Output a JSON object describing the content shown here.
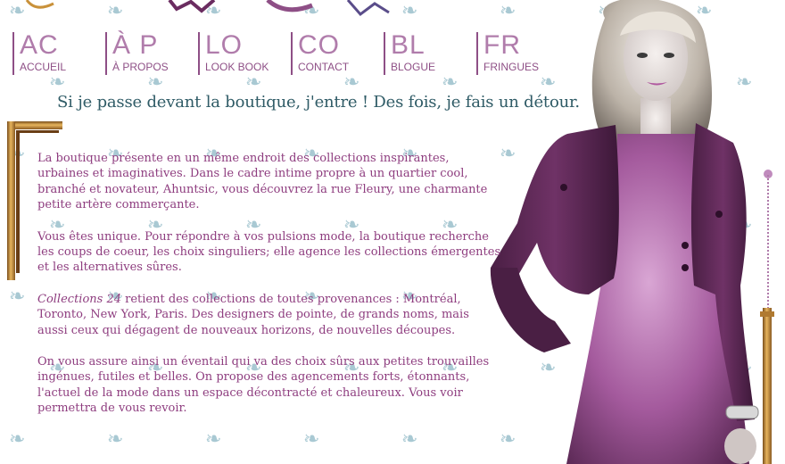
{
  "nav": {
    "items": [
      {
        "abbr": "AC",
        "label": "ACCUEIL"
      },
      {
        "abbr": "À P",
        "label": "À PROPOS"
      },
      {
        "abbr": "LO",
        "label": "LOOK BOOK"
      },
      {
        "abbr": "CO",
        "label": "CONTACT"
      },
      {
        "abbr": "BL",
        "label": "BLOGUE"
      },
      {
        "abbr": "FR",
        "label": "FRINGUES"
      }
    ]
  },
  "headline": "Si je passe devant la boutique, j'entre ! Des fois, je fais un détour.",
  "content": {
    "p1": "La boutique présente en un même endroit des collections inspirantes, urbaines et imaginatives. Dans le cadre intime propre à un quartier cool, branché et novateur, Ahuntsic, vous découvrez la rue Fleury, une charmante petite artère commerçante.",
    "p2": "Vous êtes unique. Pour répondre à vos pulsions mode, la boutique recherche les coups de coeur, les choix singuliers; elle agence les collections émergentes et les alternatives sûres.",
    "p3_em": "Collections 24",
    "p3_rest": " retient des collections de toutes provenances : Montréal, Toronto, New York, Paris. Des designers de pointe, de grands noms, mais aussi ceux qui dégagent de nouveaux horizons, de nouvelles découpes.",
    "p4": "On vous assure ainsi un éventail qui va des choix sûrs aux petites trouvailles ingénues, futiles et belles. On propose des agencements forts, étonnants, l'actuel de la mode dans un espace décontracté et chaleureux. Vous voir permettra de vous revoir."
  },
  "colors": {
    "text": "#8e3d7f",
    "headline": "#2f5b66",
    "nav": "#b07cab",
    "pattern": "#a9c9d3",
    "gold": "#c9913a"
  },
  "icons": [
    "bow-pattern-icon",
    "gold-rod-frame",
    "model-photo"
  ]
}
